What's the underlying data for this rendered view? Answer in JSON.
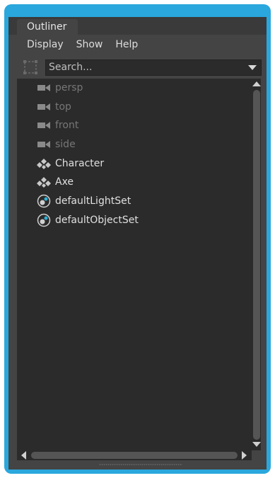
{
  "panel": {
    "tab_label": "Outliner"
  },
  "menu": {
    "items": [
      "Display",
      "Show",
      "Help"
    ]
  },
  "search": {
    "placeholder": "Search..."
  },
  "outliner": {
    "items": [
      {
        "label": "persp",
        "icon": "camera-icon",
        "dimmed": true
      },
      {
        "label": "top",
        "icon": "camera-icon",
        "dimmed": true
      },
      {
        "label": "front",
        "icon": "camera-icon",
        "dimmed": true
      },
      {
        "label": "side",
        "icon": "camera-icon",
        "dimmed": true
      },
      {
        "label": "Character",
        "icon": "transform-group-icon",
        "dimmed": false
      },
      {
        "label": "Axe",
        "icon": "transform-group-icon",
        "dimmed": false
      },
      {
        "label": "defaultLightSet",
        "icon": "object-set-icon",
        "dimmed": false
      },
      {
        "label": "defaultObjectSet",
        "icon": "object-set-icon",
        "dimmed": false
      }
    ]
  },
  "colors": {
    "frame_border": "#2aa7dc",
    "panel_bg": "#444444",
    "list_bg": "#2b2b2b",
    "dim_text": "#777777",
    "bright_text": "#e0e0e0"
  }
}
